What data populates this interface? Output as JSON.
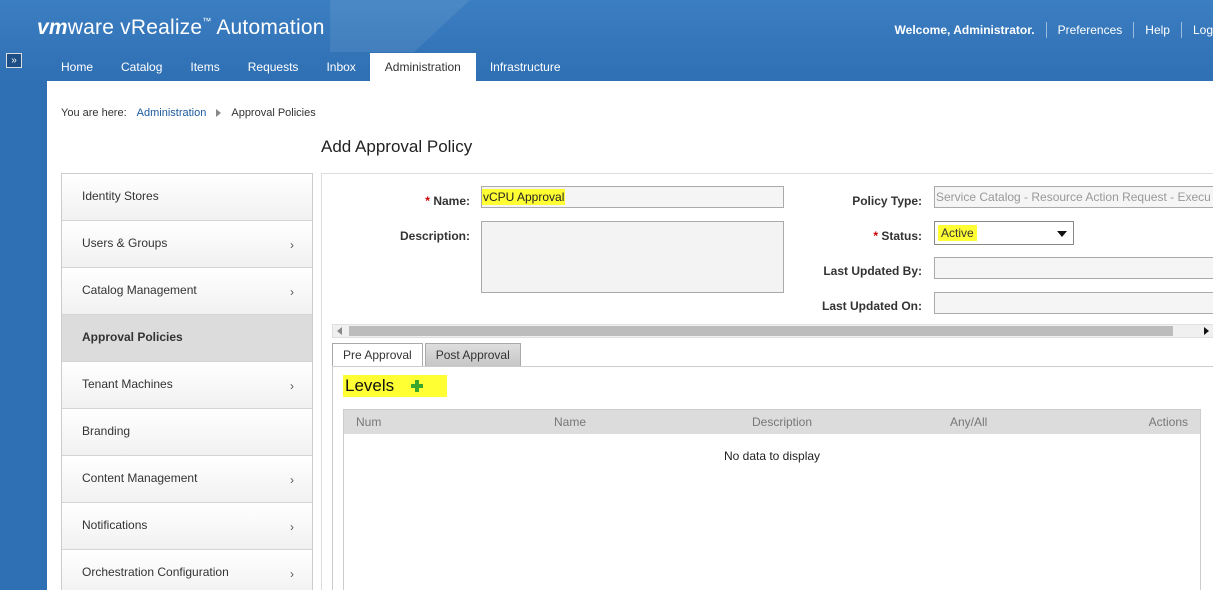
{
  "header": {
    "logo_vm": "vm",
    "logo_ware": "ware",
    "logo_product": " vRealize",
    "logo_tm": "™",
    "logo_suffix": " Automation",
    "welcome": "Welcome, Administrator.",
    "links": [
      "Preferences",
      "Help",
      "Log"
    ]
  },
  "nav": {
    "tabs": [
      {
        "label": "Home"
      },
      {
        "label": "Catalog"
      },
      {
        "label": "Items"
      },
      {
        "label": "Requests"
      },
      {
        "label": "Inbox"
      },
      {
        "label": "Administration",
        "active": true
      },
      {
        "label": "Infrastructure"
      }
    ]
  },
  "toggle": "»",
  "breadcrumb": {
    "prefix": "You are here:",
    "link": "Administration",
    "current": "Approval Policies"
  },
  "page_title": "Add Approval Policy",
  "sidebar": {
    "items": [
      {
        "label": "Identity Stores",
        "chevron": false
      },
      {
        "label": "Users & Groups",
        "chevron": true
      },
      {
        "label": "Catalog Management",
        "chevron": true
      },
      {
        "label": "Approval Policies",
        "chevron": false,
        "selected": true
      },
      {
        "label": "Tenant Machines",
        "chevron": true
      },
      {
        "label": "Branding",
        "chevron": false
      },
      {
        "label": "Content Management",
        "chevron": true
      },
      {
        "label": "Notifications",
        "chevron": true
      },
      {
        "label": "Orchestration Configuration",
        "chevron": true
      }
    ]
  },
  "form": {
    "required_mark": "*",
    "name_label": "Name:",
    "name_value": "vCPU Approval",
    "description_label": "Description:",
    "description_value": "",
    "policy_type_label": "Policy Type:",
    "policy_type_value": "Service Catalog - Resource Action Request - Execu",
    "status_label": "Status:",
    "status_value": "Active",
    "last_updated_by_label": "Last Updated By:",
    "last_updated_by_value": "",
    "last_updated_on_label": "Last Updated On:",
    "last_updated_on_value": ""
  },
  "tabs": {
    "pre": "Pre Approval",
    "post": "Post Approval"
  },
  "levels": {
    "title": "Levels",
    "columns": [
      "Num",
      "Name",
      "Description",
      "Any/All",
      "Actions"
    ],
    "empty_text": "No data to display"
  },
  "colors": {
    "header_blue": "#3b7ec1",
    "highlight": "#ffff33",
    "add_green": "#3aa62c",
    "required_red": "#c00000"
  }
}
